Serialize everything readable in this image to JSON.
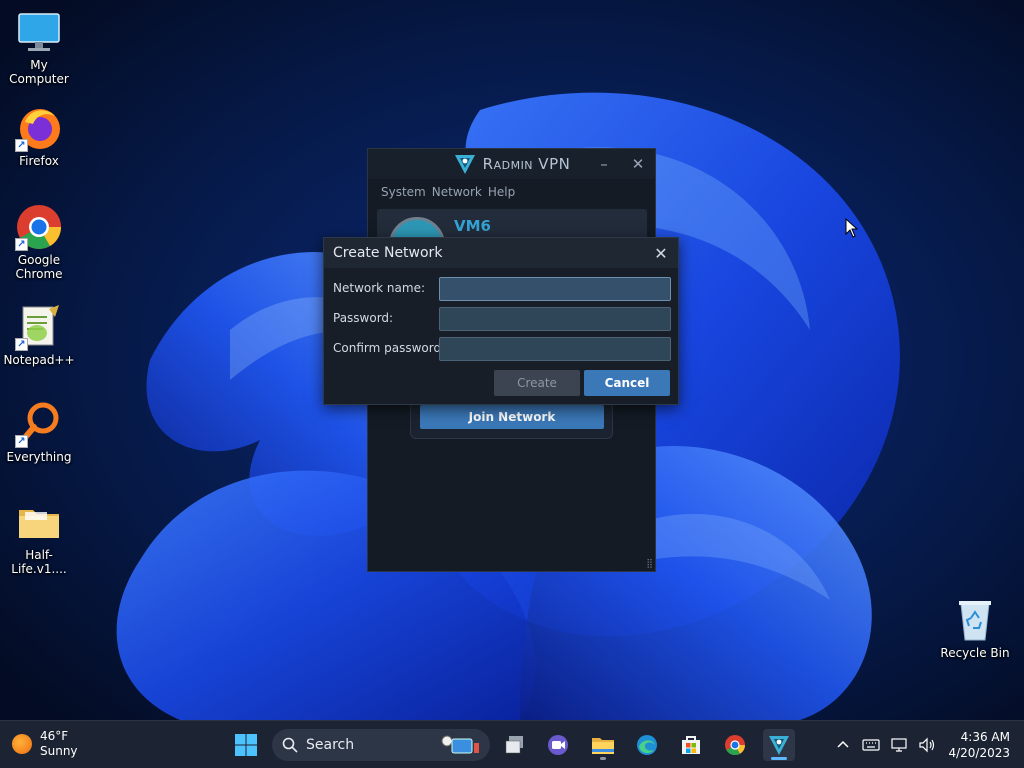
{
  "desktop": {
    "icons": [
      {
        "label": "My Computer"
      },
      {
        "label": "Firefox"
      },
      {
        "label": "Google Chrome"
      },
      {
        "label": "Notepad++"
      },
      {
        "label": "Everything"
      },
      {
        "label": "Half-Life.v1...."
      },
      {
        "label": "Recycle Bin"
      }
    ]
  },
  "radmin": {
    "title": "Radmin VPN",
    "menu": [
      "System",
      "Network",
      "Help"
    ],
    "profile_name": "VM6",
    "join_button": "Join Network"
  },
  "dialog": {
    "title": "Create Network",
    "fields": [
      {
        "label": "Network name:",
        "value": "",
        "placeholder": ""
      },
      {
        "label": "Password:",
        "value": "",
        "placeholder": ""
      },
      {
        "label": "Confirm password:",
        "value": "",
        "placeholder": ""
      }
    ],
    "create_label": "Create",
    "cancel_label": "Cancel"
  },
  "taskbar": {
    "weather_temp": "46°F",
    "weather_desc": "Sunny",
    "search_label": "Search",
    "apps": [
      "start-icon",
      "search",
      "task-view-icon",
      "teams-chat-icon",
      "file-explorer-icon",
      "edge-icon",
      "store-icon",
      "chrome-icon",
      "radmin-vpn-icon"
    ],
    "clock_time": "4:36 AM",
    "clock_date": "4/20/2023"
  },
  "colors": {
    "accent": "#3b78b8",
    "radmin_bg": "#141b25",
    "taskbar_bg": "#1c2433"
  }
}
